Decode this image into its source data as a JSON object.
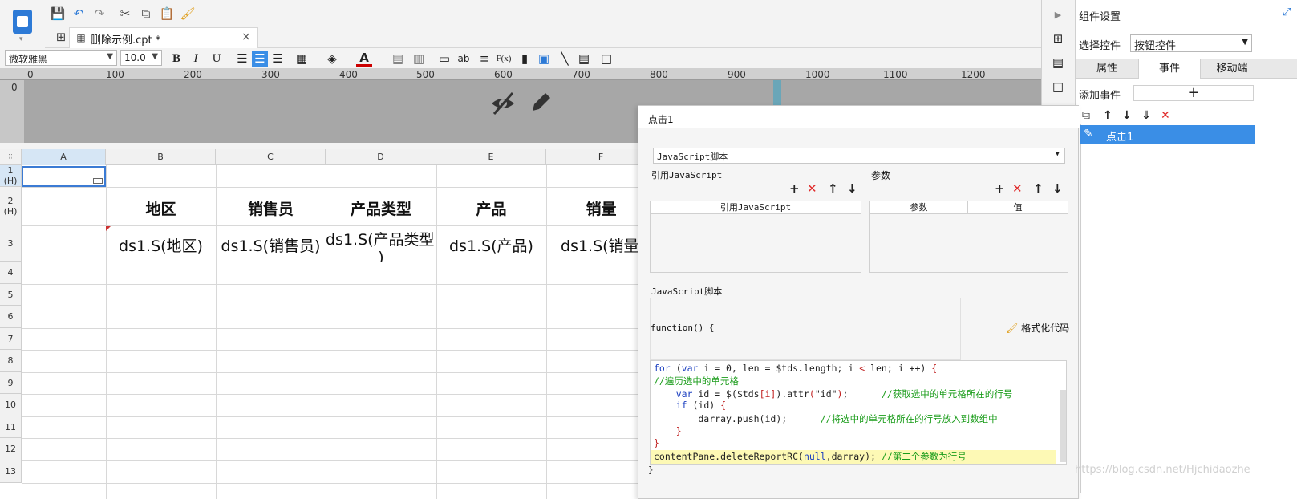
{
  "file_tab": {
    "label": "删除示例.cpt *",
    "close": "×"
  },
  "font": {
    "name": "微软雅黑",
    "size": "10.0"
  },
  "format_buttons": {
    "bold": "B",
    "italic": "I",
    "underline": "U",
    "text_style": "ab",
    "formula": "F(x)"
  },
  "ruler": {
    "h_ticks": [
      "0",
      "100",
      "200",
      "300",
      "400",
      "500",
      "600",
      "700",
      "800",
      "900",
      "1000",
      "1100",
      "1200"
    ],
    "v_tick": "0"
  },
  "grid": {
    "columns": [
      "A",
      "B",
      "C",
      "D",
      "E",
      "F"
    ],
    "rows": [
      "1 (H)",
      "2 (H)",
      "3",
      "4",
      "5",
      "6",
      "7",
      "8",
      "9",
      "10",
      "11",
      "12",
      "13"
    ],
    "headers": [
      "地区",
      "销售员",
      "产品类型",
      "产品",
      "销量"
    ],
    "formulas": [
      "ds1.S(地区)",
      "ds1.S(销售员)",
      "ds1.S(产品类型)",
      "ds1.S(产品)",
      "ds1.S(销量"
    ],
    "formula_wrap": ")"
  },
  "right_panel": {
    "title": "组件设置",
    "select_label": "选择控件",
    "select_value": "按钮控件",
    "tabs": [
      "属性",
      "事件",
      "移动端"
    ],
    "add_event_label": "添加事件",
    "add_button": "+",
    "event_item": "点击1"
  },
  "dialog": {
    "title": "点击1",
    "script_type": "JavaScript脚本",
    "ref_js_label": "引用JavaScript",
    "params_label": "参数",
    "ref_js_header": "引用JavaScript",
    "param_header": "参数",
    "value_header": "值",
    "script_label": "JavaScript脚本",
    "function_sig": "function() {",
    "format_button": "格式化代码",
    "closing_brace": "}",
    "code": [
      "for (var i = 0, len = $tds.length; i < len; i ++) {",
      "//遍历选中的单元格",
      "    var id = $($tds[i]).attr(\"id\");      //获取选中的单元格所在的行号",
      "    if (id) {",
      "        darray.push(id);      //将选中的单元格所在的行号放入到数组中",
      "    }",
      "}",
      "contentPane.deleteReportRC(null,darray); //第二个参数为行号"
    ]
  },
  "watermark": "https://blog.csdn.net/Hjchidaozhe"
}
